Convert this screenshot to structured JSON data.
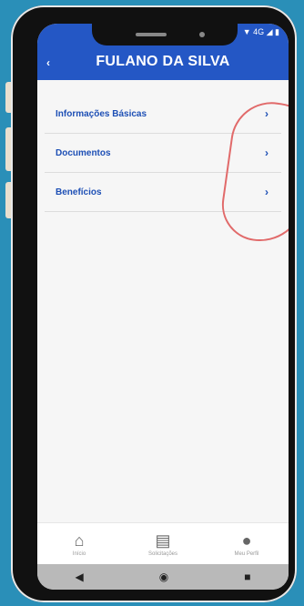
{
  "status_bar": {
    "icons": "▼ 4G ◢ ▮"
  },
  "header": {
    "back_icon": "‹",
    "title": "FULANO DA SILVA"
  },
  "menu": {
    "items": [
      {
        "label": "Informações Básicas",
        "chevron": "›"
      },
      {
        "label": "Documentos",
        "chevron": "›"
      },
      {
        "label": "Benefícios",
        "chevron": "›"
      }
    ]
  },
  "bottom_nav": {
    "items": [
      {
        "icon": "⌂",
        "label": "Início"
      },
      {
        "icon": "▤",
        "label": "Solicitações"
      },
      {
        "icon": "●",
        "label": "Meu Perfil"
      }
    ]
  },
  "android_nav": {
    "back": "◀",
    "home": "◉",
    "recent": "■"
  },
  "colors": {
    "header": "#2457c5",
    "accent": "#1d4fb5",
    "annotation": "#e16a6a",
    "background": "#2a8fb8"
  }
}
